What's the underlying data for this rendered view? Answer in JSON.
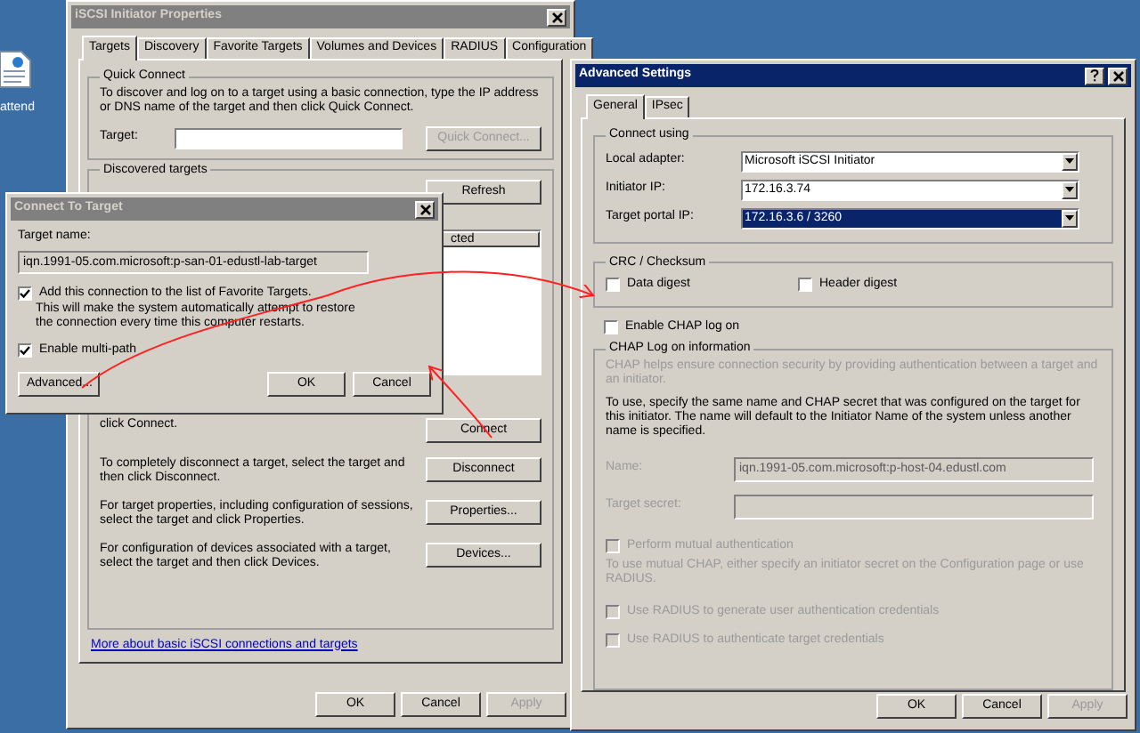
{
  "desktop": {
    "icons": [
      {
        "label": "attend"
      }
    ]
  },
  "iscsi_window": {
    "title": "iSCSI Initiator Properties",
    "active": false,
    "tabs": [
      {
        "label": "Targets",
        "selected": true
      },
      {
        "label": "Discovery",
        "selected": false
      },
      {
        "label": "Favorite Targets",
        "selected": false
      },
      {
        "label": "Volumes and Devices",
        "selected": false
      },
      {
        "label": "RADIUS",
        "selected": false
      },
      {
        "label": "Configuration",
        "selected": false
      }
    ],
    "quick_connect": {
      "title": "Quick Connect",
      "description": "To discover and log on to a target using a basic connection, type the IP address or DNS name of the target and then click Quick Connect.",
      "target_label": "Target:",
      "button": {
        "label": "Quick Connect...",
        "disabled": true
      }
    },
    "discovered_targets": {
      "title": "Discovered targets",
      "refresh_button": "Refresh",
      "column_header": "cted",
      "actions": [
        {
          "text": "click Connect.",
          "button": "Connect"
        },
        {
          "text": "To completely disconnect a target, select the target and then click Disconnect.",
          "button": "Disconnect"
        },
        {
          "text": "For target properties, including configuration of sessions, select the target and click Properties.",
          "button": "Properties..."
        },
        {
          "text": "For configuration of devices associated with a target, select the target and then click Devices.",
          "button": "Devices..."
        }
      ]
    },
    "link": "More about basic iSCSI connections and targets",
    "buttons": [
      {
        "label": "OK",
        "disabled": false
      },
      {
        "label": "Cancel",
        "disabled": false
      },
      {
        "label": "Apply",
        "disabled": true
      }
    ]
  },
  "connect_dialog": {
    "title": "Connect To Target",
    "active": false,
    "target_name_label": "Target name:",
    "target_name": "iqn.1991-05.com.microsoft:p-san-01-edustl-lab-target",
    "favorite": {
      "label": "Add this connection to the list of Favorite Targets.",
      "checked": true,
      "note": "This will make the system automatically attempt to restore the connection every time this computer restarts."
    },
    "multipath": {
      "label": "Enable multi-path",
      "checked": true
    },
    "advanced_button": "Advanced...",
    "buttons": [
      {
        "label": "OK",
        "disabled": false
      },
      {
        "label": "Cancel",
        "disabled": false
      }
    ]
  },
  "advanced_window": {
    "title": "Advanced Settings",
    "active": true,
    "tabs": [
      {
        "label": "General",
        "selected": true
      },
      {
        "label": "IPsec",
        "selected": false
      }
    ],
    "connect_using": {
      "title": "Connect using",
      "rows": [
        {
          "label": "Local adapter:",
          "value": "Microsoft iSCSI Initiator",
          "selected": false
        },
        {
          "label": "Initiator IP:",
          "value": "172.16.3.74",
          "selected": false
        },
        {
          "label": "Target portal IP:",
          "value": "172.16.3.6 / 3260",
          "selected": true
        }
      ]
    },
    "crc": {
      "title": "CRC / Checksum",
      "options": [
        {
          "label": "Data digest",
          "checked": false
        },
        {
          "label": "Header digest",
          "checked": false
        }
      ]
    },
    "enable_chap": {
      "label": "Enable CHAP log on",
      "checked": false
    },
    "chap": {
      "title": "CHAP Log on information",
      "description": "CHAP helps ensure connection security by providing authentication between a target and an initiator.",
      "instructions": "To use, specify the same name and CHAP secret that was configured on the target for this initiator.  The name will default to the Initiator Name of the system unless another name is specified.",
      "fields": [
        {
          "label": "Name:",
          "value": "iqn.1991-05.com.microsoft:p-host-04.edustl.com",
          "disabled": true
        },
        {
          "label": "Target secret:",
          "disabled": true
        }
      ],
      "mutual": {
        "label": "Perform mutual authentication",
        "checked": false,
        "disabled": true
      },
      "mutual_note": "To use mutual CHAP, either specify an initiator secret on the Configuration page or use RADIUS.",
      "radius_options": [
        {
          "label": "Use RADIUS to generate user authentication credentials",
          "checked": false,
          "disabled": true
        },
        {
          "label": "Use RADIUS to authenticate target credentials",
          "checked": false,
          "disabled": true
        }
      ]
    },
    "buttons": [
      {
        "label": "OK",
        "disabled": false
      },
      {
        "label": "Cancel",
        "disabled": false
      },
      {
        "label": "Apply",
        "disabled": true
      }
    ]
  }
}
